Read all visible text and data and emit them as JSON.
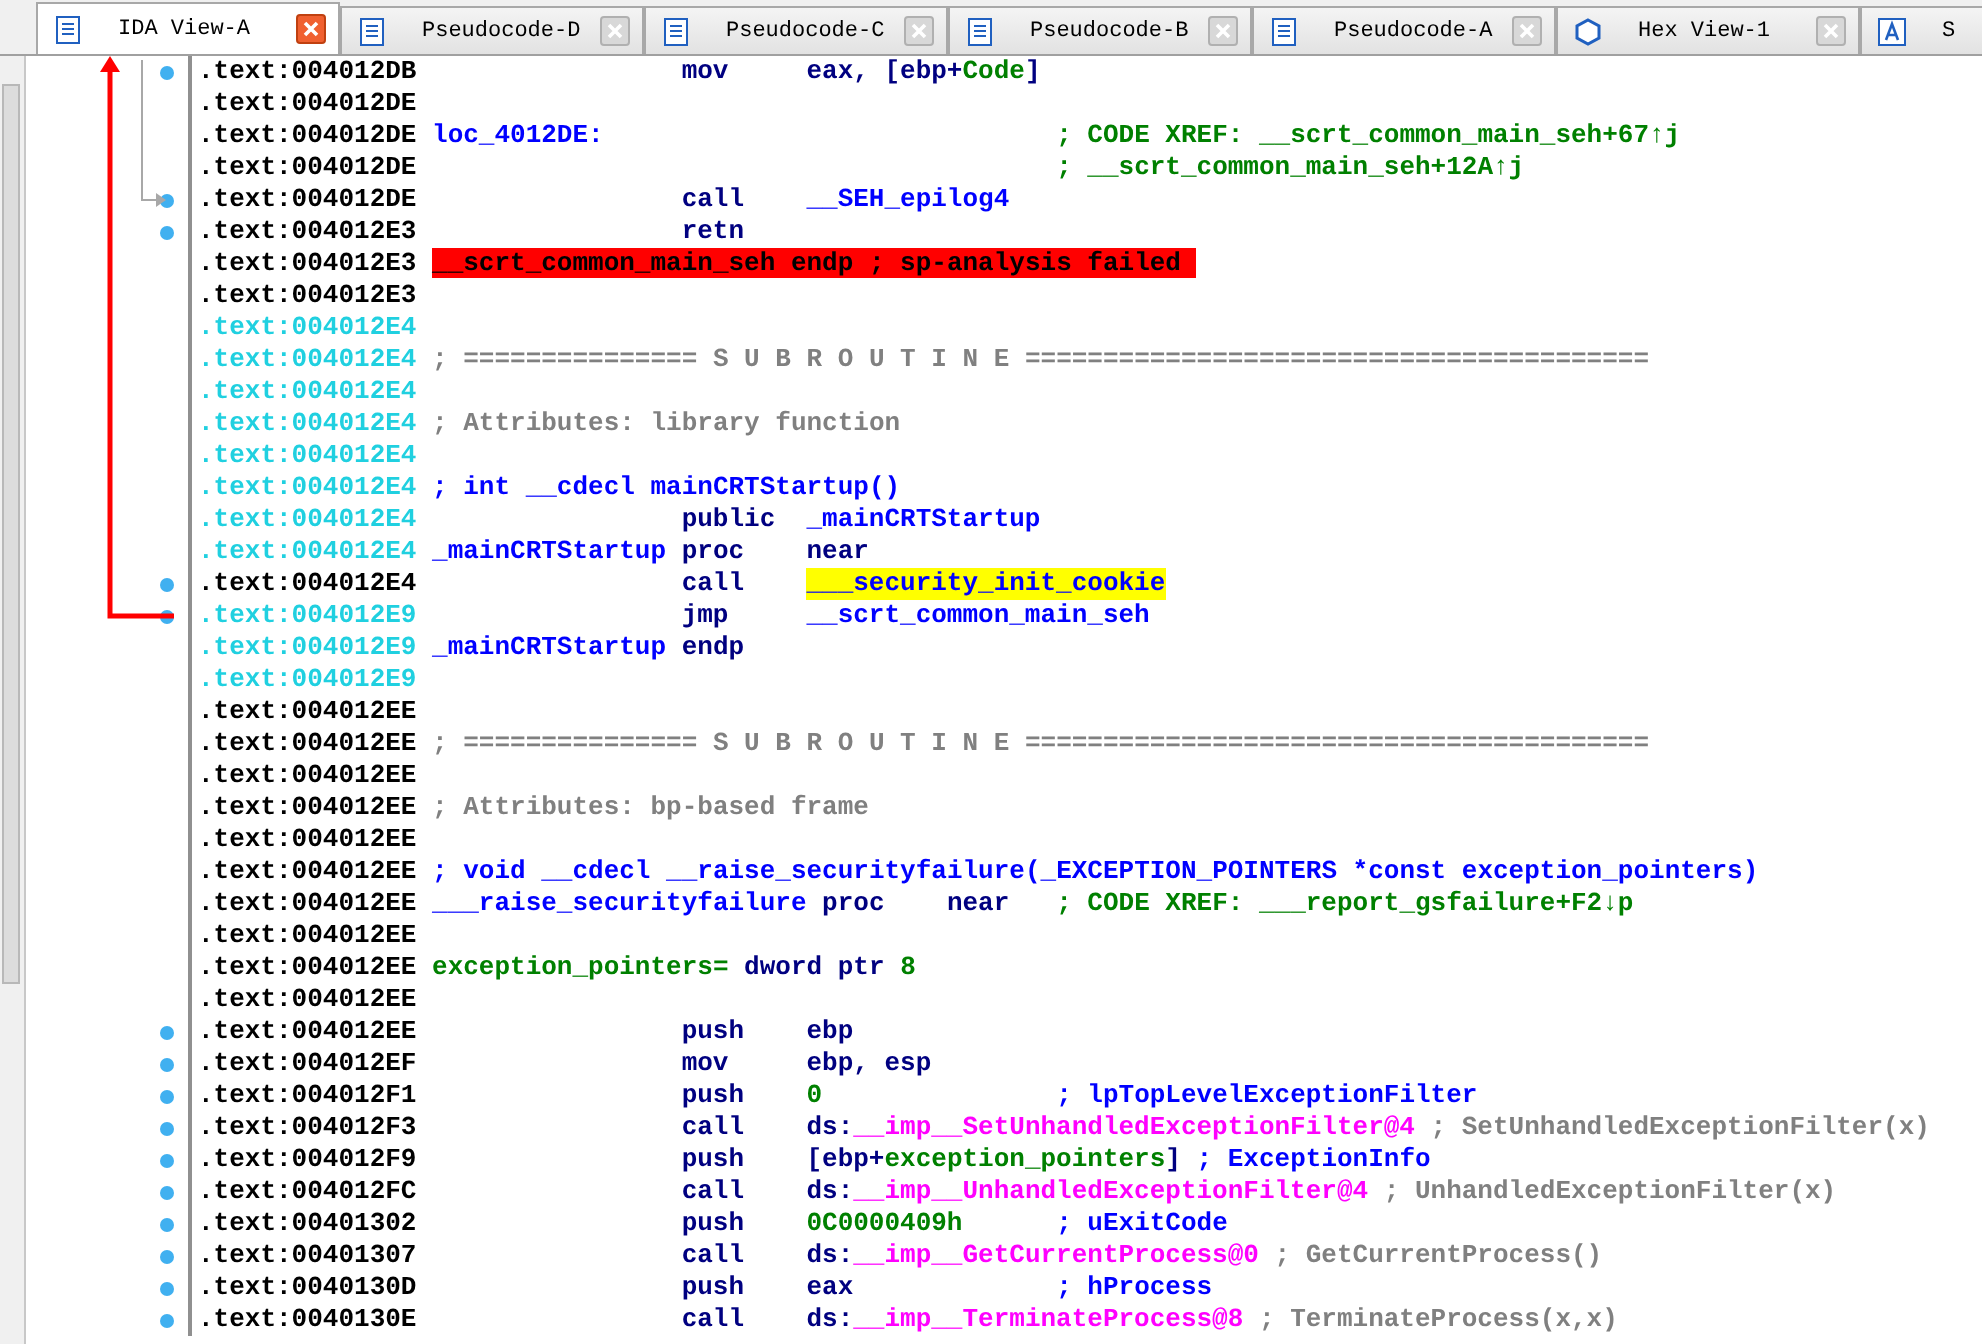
{
  "tabs": [
    {
      "label": "IDA View-A",
      "selected": true,
      "kind": "disasm"
    },
    {
      "label": "Pseudocode-D",
      "selected": false,
      "kind": "pseudocode"
    },
    {
      "label": "Pseudocode-C",
      "selected": false,
      "kind": "pseudocode"
    },
    {
      "label": "Pseudocode-B",
      "selected": false,
      "kind": "pseudocode"
    },
    {
      "label": "Pseudocode-A",
      "selected": false,
      "kind": "pseudocode"
    },
    {
      "label": "Hex View-1",
      "selected": false,
      "kind": "hex"
    },
    {
      "label": "S",
      "selected": false,
      "kind": "struct"
    }
  ],
  "lines": [
    {
      "address": ".text:004012DB",
      "lib": false,
      "dot": true,
      "mnemonic": "mov",
      "operands": [
        {
          "text": "eax, [ebp+",
          "kind": "operand"
        },
        {
          "text": "Code",
          "kind": "var"
        },
        {
          "text": "]",
          "kind": "operand"
        }
      ]
    },
    {
      "address": ".text:004012DE",
      "lib": false,
      "dot": false
    },
    {
      "address": ".text:004012DE",
      "lib": false,
      "dot": false,
      "label": {
        "text": "loc_4012DE:",
        "kind": "label"
      },
      "comment": {
        "text": "; CODE XREF: __scrt_common_main_seh+67↑j",
        "kind": "xref"
      }
    },
    {
      "address": ".text:004012DE",
      "lib": false,
      "dot": false,
      "comment": {
        "text": "; __scrt_common_main_seh+12A↑j",
        "kind": "xref"
      }
    },
    {
      "address": ".text:004012DE",
      "lib": false,
      "dot": true,
      "mnemonic": "call",
      "operands": [
        {
          "text": "__SEH_epilog4",
          "kind": "name"
        }
      ]
    },
    {
      "address": ".text:004012E3",
      "lib": false,
      "dot": true,
      "mnemonic": "retn"
    },
    {
      "address": ".text:004012E3",
      "lib": false,
      "dot": false,
      "label": {
        "text": "__scrt_common_main_seh endp ; sp-analysis failed",
        "kind": "error"
      }
    },
    {
      "address": ".text:004012E3",
      "lib": false,
      "dot": false
    },
    {
      "address": ".text:004012E4",
      "lib": true,
      "dot": false
    },
    {
      "address": ".text:004012E4",
      "lib": true,
      "dot": false,
      "comment": {
        "text": "; =============== S U B R O U T I N E ========================================",
        "kind": "comment"
      }
    },
    {
      "address": ".text:004012E4",
      "lib": true,
      "dot": false
    },
    {
      "address": ".text:004012E4",
      "lib": true,
      "dot": false,
      "comment": {
        "text": "; Attributes: library function",
        "kind": "comment"
      }
    },
    {
      "address": ".text:004012E4",
      "lib": true,
      "dot": false
    },
    {
      "address": ".text:004012E4",
      "lib": true,
      "dot": false,
      "comment": {
        "text": "; int __cdecl mainCRTStartup()",
        "kind": "note"
      }
    },
    {
      "address": ".text:004012E4",
      "lib": true,
      "dot": false,
      "mnemonic": "public",
      "operands": [
        {
          "text": "_mainCRTStartup",
          "kind": "name"
        }
      ]
    },
    {
      "address": ".text:004012E4",
      "lib": true,
      "dot": false,
      "label": {
        "text": "_mainCRTStartup",
        "kind": "label"
      },
      "mnemonic": "proc",
      "operands": [
        {
          "text": "near",
          "kind": "operand"
        }
      ]
    },
    {
      "address": ".text:004012E4",
      "lib": false,
      "dot": true,
      "mnemonic": "call",
      "operands": [
        {
          "text": "___security_init_cookie",
          "kind": "highlight"
        }
      ]
    },
    {
      "address": ".text:004012E9",
      "lib": true,
      "dot": true,
      "mnemonic": "jmp",
      "operands": [
        {
          "text": "__scrt_common_main_seh",
          "kind": "name"
        }
      ]
    },
    {
      "address": ".text:004012E9",
      "lib": true,
      "dot": false,
      "label": {
        "text": "_mainCRTStartup",
        "kind": "label"
      },
      "mnemonic": "endp"
    },
    {
      "address": ".text:004012E9",
      "lib": true,
      "dot": false
    },
    {
      "address": ".text:004012EE",
      "lib": false,
      "dot": false
    },
    {
      "address": ".text:004012EE",
      "lib": false,
      "dot": false,
      "comment": {
        "text": "; =============== S U B R O U T I N E ========================================",
        "kind": "comment"
      }
    },
    {
      "address": ".text:004012EE",
      "lib": false,
      "dot": false
    },
    {
      "address": ".text:004012EE",
      "lib": false,
      "dot": false,
      "comment": {
        "text": "; Attributes: bp-based frame",
        "kind": "comment"
      }
    },
    {
      "address": ".text:004012EE",
      "lib": false,
      "dot": false
    },
    {
      "address": ".text:004012EE",
      "lib": false,
      "dot": false,
      "comment": {
        "text": "; void __cdecl __raise_securityfailure(_EXCEPTION_POINTERS *const exception_pointers)",
        "kind": "note"
      }
    },
    {
      "address": ".text:004012EE",
      "lib": false,
      "dot": false,
      "label": {
        "text": "___raise_securityfailure",
        "kind": "label"
      },
      "mnemonic": "proc",
      "operands": [
        {
          "text": "near",
          "kind": "operand"
        }
      ],
      "comment": {
        "text": "; CODE XREF: ___report_gsfailure+F2↓p",
        "kind": "xref"
      }
    },
    {
      "address": ".text:004012EE",
      "lib": false,
      "dot": false
    },
    {
      "address": ".text:004012EE",
      "lib": false,
      "dot": false,
      "label": {
        "text": "exception_pointers=",
        "kind": "var"
      },
      "mnemonic": "dword ptr",
      "operands": [
        {
          "text": "8",
          "kind": "number"
        }
      ]
    },
    {
      "address": ".text:004012EE",
      "lib": false,
      "dot": false
    },
    {
      "address": ".text:004012EE",
      "lib": false,
      "dot": true,
      "mnemonic": "push",
      "operands": [
        {
          "text": "ebp",
          "kind": "operand"
        }
      ]
    },
    {
      "address": ".text:004012EF",
      "lib": false,
      "dot": true,
      "mnemonic": "mov",
      "operands": [
        {
          "text": "ebp, esp",
          "kind": "operand"
        }
      ]
    },
    {
      "address": ".text:004012F1",
      "lib": false,
      "dot": true,
      "mnemonic": "push",
      "operands": [
        {
          "text": "0",
          "kind": "number"
        }
      ],
      "comment": {
        "text": "; lpTopLevelExceptionFilter",
        "kind": "note"
      }
    },
    {
      "address": ".text:004012F3",
      "lib": false,
      "dot": true,
      "mnemonic": "call",
      "operands": [
        {
          "text": "ds:",
          "kind": "operand"
        },
        {
          "text": "__imp__SetUnhandledExceptionFilter@4",
          "kind": "import"
        }
      ],
      "comment": {
        "text": "; SetUnhandledExceptionFilter(x)",
        "kind": "comment"
      }
    },
    {
      "address": ".text:004012F9",
      "lib": false,
      "dot": true,
      "mnemonic": "push",
      "operands": [
        {
          "text": "[ebp+",
          "kind": "operand"
        },
        {
          "text": "exception_pointers",
          "kind": "var"
        },
        {
          "text": "]",
          "kind": "operand"
        }
      ],
      "comment": {
        "text": "; ExceptionInfo",
        "kind": "note"
      }
    },
    {
      "address": ".text:004012FC",
      "lib": false,
      "dot": true,
      "mnemonic": "call",
      "operands": [
        {
          "text": "ds:",
          "kind": "operand"
        },
        {
          "text": "__imp__UnhandledExceptionFilter@4",
          "kind": "import"
        }
      ],
      "comment": {
        "text": "; UnhandledExceptionFilter(x)",
        "kind": "comment"
      }
    },
    {
      "address": ".text:00401302",
      "lib": false,
      "dot": true,
      "mnemonic": "push",
      "operands": [
        {
          "text": "0C0000409h",
          "kind": "number"
        }
      ],
      "comment": {
        "text": "; uExitCode",
        "kind": "note"
      }
    },
    {
      "address": ".text:00401307",
      "lib": false,
      "dot": true,
      "mnemonic": "call",
      "operands": [
        {
          "text": "ds:",
          "kind": "operand"
        },
        {
          "text": "__imp__GetCurrentProcess@0",
          "kind": "import"
        }
      ],
      "comment": {
        "text": "; GetCurrentProcess()",
        "kind": "comment"
      }
    },
    {
      "address": ".text:0040130D",
      "lib": false,
      "dot": true,
      "mnemonic": "push",
      "operands": [
        {
          "text": "eax",
          "kind": "operand"
        }
      ],
      "comment": {
        "text": "; hProcess",
        "kind": "note"
      }
    },
    {
      "address": ".text:0040130E",
      "lib": false,
      "dot": true,
      "mnemonic": "call",
      "operands": [
        {
          "text": "ds:",
          "kind": "operand"
        },
        {
          "text": "__imp__TerminateProcess@8",
          "kind": "import"
        }
      ],
      "comment": {
        "text": "; TerminateProcess(x,x)",
        "kind": "comment"
      }
    }
  ]
}
